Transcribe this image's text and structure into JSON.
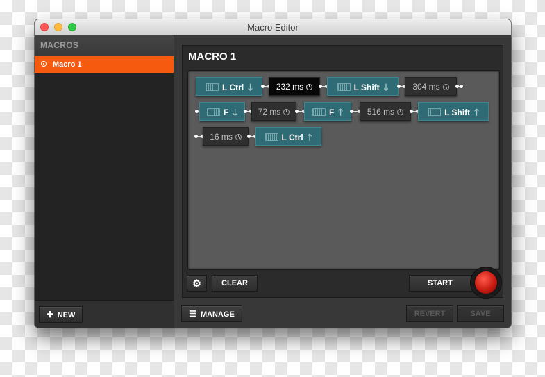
{
  "window": {
    "title": "Macro Editor"
  },
  "sidebar": {
    "header": "MACROS",
    "items": [
      {
        "label": "Macro 1",
        "selected": true
      }
    ],
    "new_label": "NEW"
  },
  "editor": {
    "title": "MACRO 1",
    "steps": [
      {
        "type": "key",
        "label": "L Ctrl",
        "direction": "down"
      },
      {
        "type": "delay",
        "label": "232 ms",
        "active": true
      },
      {
        "type": "key",
        "label": "L Shift",
        "direction": "down"
      },
      {
        "type": "delay",
        "label": "304 ms"
      },
      {
        "type": "key",
        "label": "F",
        "direction": "down"
      },
      {
        "type": "delay",
        "label": "72 ms"
      },
      {
        "type": "key",
        "label": "F",
        "direction": "up"
      },
      {
        "type": "delay",
        "label": "516 ms"
      },
      {
        "type": "key",
        "label": "L Shift",
        "direction": "up"
      },
      {
        "type": "delay",
        "label": "16 ms"
      },
      {
        "type": "key",
        "label": "L Ctrl",
        "direction": "up"
      }
    ],
    "clear_label": "CLEAR",
    "start_label": "START"
  },
  "footer": {
    "manage_label": "MANAGE",
    "revert_label": "REVERT",
    "save_label": "SAVE"
  },
  "colors": {
    "accent": "#f55a0e",
    "key_block": "#2e6b74",
    "record": "#c81c12"
  }
}
